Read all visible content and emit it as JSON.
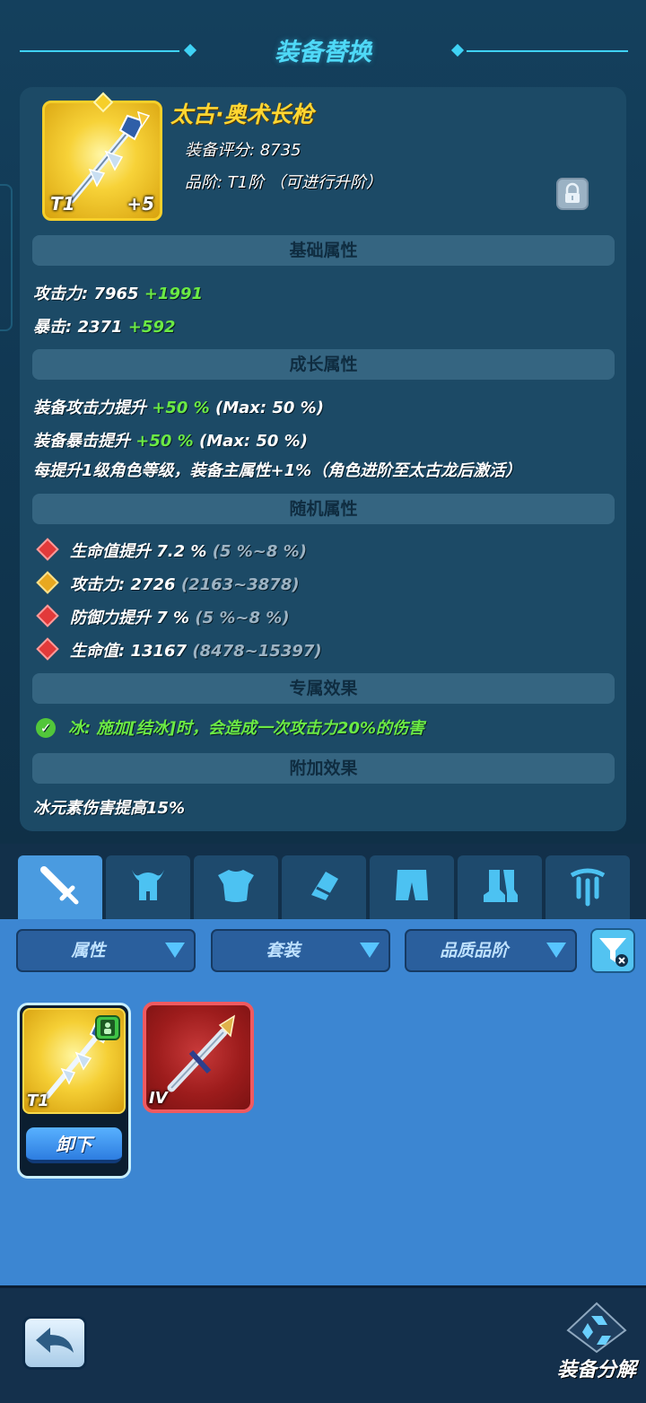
{
  "header": {
    "title": "装备替换"
  },
  "item": {
    "name": "太古·奥术长枪",
    "score_line": "装备评分: 8735",
    "grade_line": "品阶: T1阶 （可进行升阶）",
    "tier": "T1",
    "enhance": "+5"
  },
  "sections": {
    "basic": "基础属性",
    "growth": "成长属性",
    "random": "随机属性",
    "exclusive": "专属效果",
    "extra": "附加效果"
  },
  "basic_stats": [
    {
      "label": "攻击力: 7965 ",
      "bonus": "+1991"
    },
    {
      "label": "暴击: 2371 ",
      "bonus": "+592"
    }
  ],
  "growth_stats": [
    {
      "label": "装备攻击力提升 ",
      "bonus": "+50 %",
      "max": " (Max: 50 %)"
    },
    {
      "label": "装备暴击提升 ",
      "bonus": "+50 %",
      "max": " (Max: 50 %)"
    }
  ],
  "growth_note": "每提升1级角色等级，装备主属性+1%（角色进阶至太古龙后激活）",
  "random_stats": [
    {
      "gem": "red",
      "label": "生命值提升 7.2 % ",
      "range": "(5 %~8 %)"
    },
    {
      "gem": "gold",
      "label": "攻击力: 2726 ",
      "range": "(2163~3878)"
    },
    {
      "gem": "red",
      "label": "防御力提升 7 % ",
      "range": "(5 %~8 %)"
    },
    {
      "gem": "red",
      "label": "生命值: 13167 ",
      "range": "(8478~15397)"
    }
  ],
  "exclusive_effect": "冰: 施加[结冰]时，会造成一次攻击力20%的伤害",
  "extra_effect": "冰元素伤害提高15%",
  "tabs": [
    {
      "icon": "sword-icon",
      "active": true
    },
    {
      "icon": "helmet-icon",
      "active": false
    },
    {
      "icon": "armor-icon",
      "active": false
    },
    {
      "icon": "gauntlet-icon",
      "active": false
    },
    {
      "icon": "pants-icon",
      "active": false
    },
    {
      "icon": "boots-icon",
      "active": false
    },
    {
      "icon": "accessory-icon",
      "active": false
    }
  ],
  "filters": {
    "attribute": "属性",
    "set": "套装",
    "quality": "品质品阶"
  },
  "inventory": [
    {
      "tier": "T1",
      "equipped": true,
      "action": "卸下"
    },
    {
      "tier": "IV",
      "equipped": false
    }
  ],
  "footer": {
    "decompose_label": "装备分解"
  },
  "colors": {
    "accent": "#4fd9f7",
    "gold": "#ffd632",
    "green": "#6bea44",
    "panel": "#1c4a66"
  }
}
